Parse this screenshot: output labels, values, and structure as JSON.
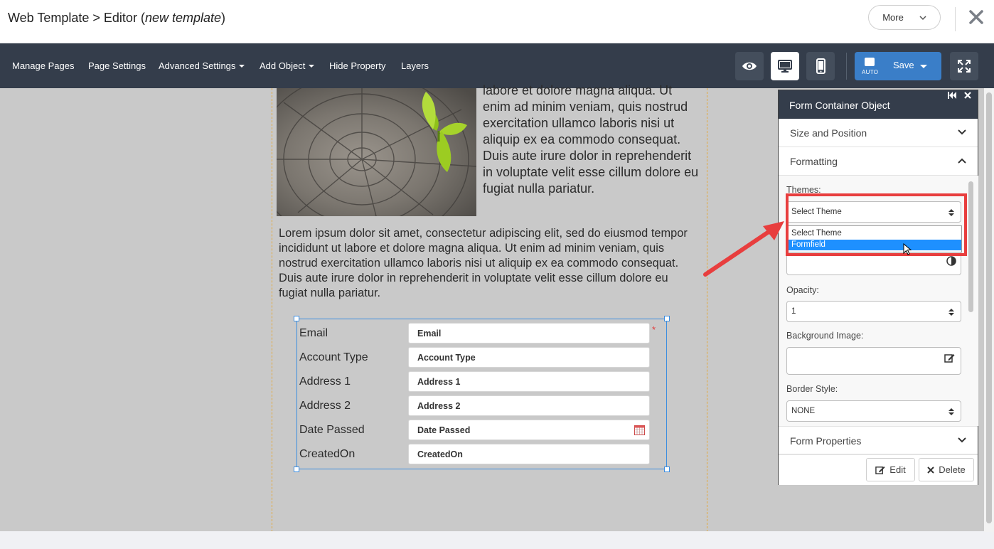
{
  "titlebar": {
    "title_prefix": "Web Template > Editor (",
    "title_italic": "new template",
    "title_suffix": ")",
    "more_label": "More"
  },
  "toolbar": {
    "menus": [
      {
        "label": "Manage Pages",
        "dropdown": false
      },
      {
        "label": "Page Settings",
        "dropdown": false
      },
      {
        "label": "Advanced Settings",
        "dropdown": true
      },
      {
        "label": "Add Object",
        "dropdown": true
      },
      {
        "label": "Hide Property",
        "dropdown": false
      },
      {
        "label": "Layers",
        "dropdown": false
      }
    ],
    "save_label": "Save",
    "save_mode": "AUTO"
  },
  "canvas": {
    "para_right": "labore et dolore magna aliqua. Ut enim ad minim veniam, quis nostrud exercitation ullamco laboris nisi ut aliquip ex ea commodo consequat. Duis aute irure dolor in reprehenderit in voluptate velit esse cillum dolore eu fugiat nulla pariatur.",
    "para_full": "Lorem ipsum dolor sit amet, consectetur adipiscing elit, sed do eiusmod tempor incididunt ut labore et dolore magna aliqua. Ut enim ad minim veniam, quis nostrud exercitation ullamco laboris nisi ut aliquip ex ea commodo consequat. Duis aute irure dolor in reprehenderit in voluptate velit esse cillum dolore eu fugiat nulla pariatur.",
    "form_fields": [
      {
        "label": "Email",
        "placeholder": "Email",
        "required": "*"
      },
      {
        "label": "Account Type",
        "placeholder": "Account Type"
      },
      {
        "label": "Address 1",
        "placeholder": "Address 1"
      },
      {
        "label": "Address 2",
        "placeholder": "Address 2"
      },
      {
        "label": "Date Passed",
        "placeholder": "Date Passed",
        "icon": "calendar-icon"
      },
      {
        "label": "CreatedOn",
        "placeholder": "CreatedOn"
      }
    ]
  },
  "panel": {
    "title": "Form Container Object",
    "sections": {
      "size_position": "Size and Position",
      "formatting": "Formatting",
      "form_properties": "Form Properties"
    },
    "themes_label": "Themes:",
    "themes_value": "Select Theme",
    "themes_options": [
      "Select Theme",
      "Formfield"
    ],
    "themes_highlighted": "Formfield",
    "opacity_label": "Opacity:",
    "opacity_value": "1",
    "bg_image_label": "Background Image:",
    "border_style_label": "Border Style:",
    "border_style_value": "NONE",
    "edit_label": "Edit",
    "delete_label": "Delete"
  },
  "colors": {
    "toolbar_bg": "#343d4b",
    "accent_blue": "#3a7ec8",
    "highlight_red": "#e83e3e",
    "selection_blue": "#1e90ff"
  }
}
